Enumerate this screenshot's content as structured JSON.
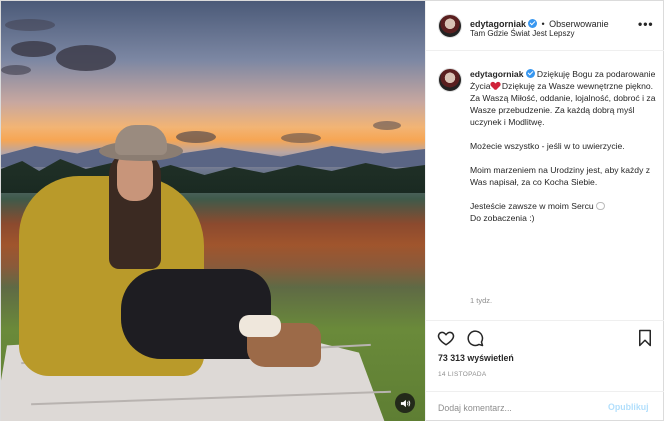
{
  "post": {
    "username": "edytagorniak",
    "follow_separator": "•",
    "follow_label": "Obserwowanie",
    "location": "Tam Gdzie Świat Jest Lepszy",
    "more_label": "•••"
  },
  "caption": {
    "username": "edytagorniak",
    "paragraph1_a": "Dziękuję Bogu za podarowanie Życia",
    "paragraph1_b": " Dziękuję za Wasze wewnętrzne piękno. Za Waszą Miłość, oddanie, lojalność, dobroć i za Wasze przebudzenie. Za każdą dobrą myśl uczynek i Modlitwę.",
    "paragraph2": "Możecie wszystko - jeśli w to uwierzycie.",
    "paragraph3": "Moim marzeniem na Urodziny jest, aby każdy z Was napisał, za co Kocha Siebie.",
    "paragraph4_a": "Jesteście zawsze w moim Sercu ",
    "paragraph4_b": "Do zobaczenia :)",
    "time": "1 tydz."
  },
  "stats": {
    "likes": "73 313 wyświetleń",
    "date": "14 listopada"
  },
  "comment": {
    "placeholder": "Dodaj komentarz...",
    "publish_label": "Opublikuj"
  },
  "icons": {
    "verified": "verified-badge-icon",
    "like": "heart-icon",
    "comment": "comment-icon",
    "save": "bookmark-icon",
    "mute": "speaker-icon"
  },
  "colors": {
    "verified": "#3897f0",
    "publish_disabled": "#b2dffc",
    "heart_emoji": "#d0233a"
  }
}
